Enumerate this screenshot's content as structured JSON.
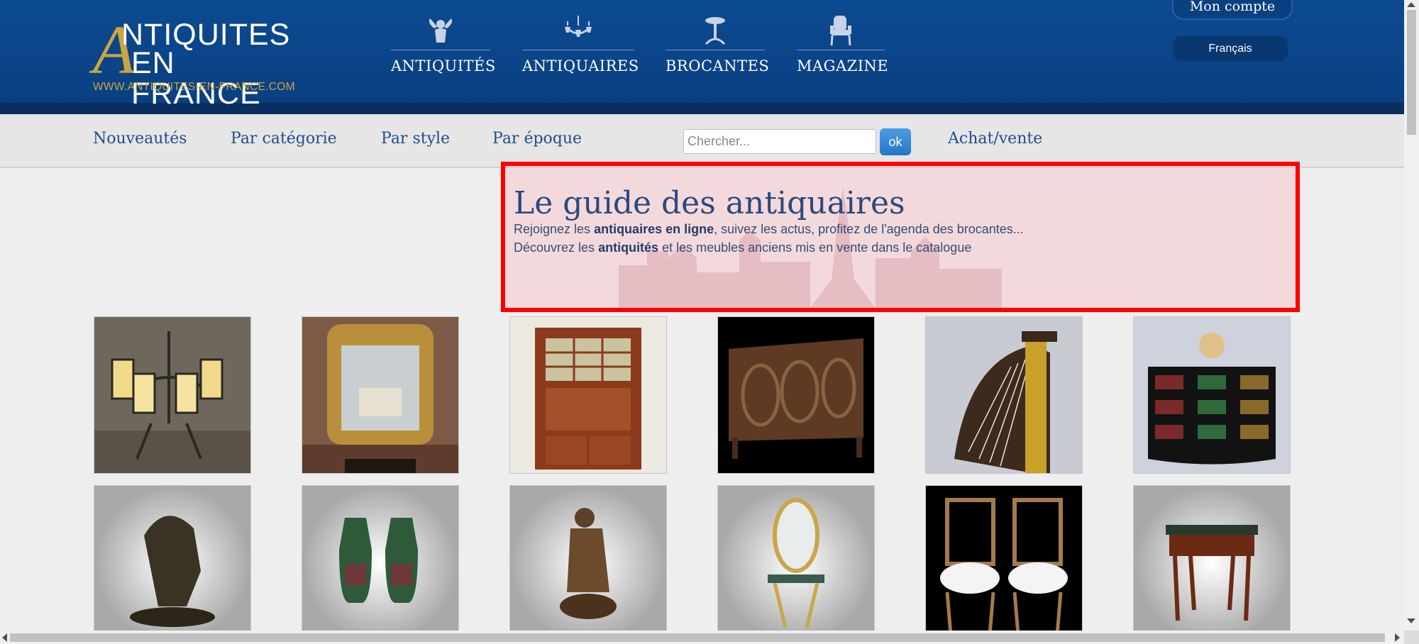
{
  "header": {
    "logo": {
      "line1": "NTIQUITES",
      "line2": "EN FRANCE",
      "big_letter": "A",
      "url": "WWW.ANTIQUITES-EN-FRANCE.COM"
    },
    "nav": [
      {
        "label": "ANTIQUITÉS",
        "icon": "cherub-icon"
      },
      {
        "label": "ANTIQUAIRES",
        "icon": "chandelier-icon"
      },
      {
        "label": "BROCANTES",
        "icon": "gueridon-table-icon"
      },
      {
        "label": "MAGAZINE",
        "icon": "armchair-icon"
      }
    ],
    "account_label": "Mon compte",
    "language": "Français"
  },
  "subnav": {
    "links": [
      "Nouveautés",
      "Par catégorie",
      "Par style",
      "Par époque"
    ],
    "search_placeholder": "Chercher...",
    "search_button": "ok",
    "buy_sell": "Achat/vente"
  },
  "hero": {
    "title": "Le guide des antiquaires",
    "line1": {
      "pre": "Rejoignez les ",
      "bold": "antiquaires en ligne",
      "post": ", suivez les actus, profitez de l'agenda des brocantes..."
    },
    "line2": {
      "pre": "Découvrez les ",
      "bold": "antiquités",
      "post": " et les meubles anciens mis en vente dans le catalogue"
    }
  },
  "products": [
    {
      "name": "lantern-chandelier-photo"
    },
    {
      "name": "gilded-mirror-photo"
    },
    {
      "name": "secretary-desk-photo"
    },
    {
      "name": "carved-sideboard-photo"
    },
    {
      "name": "golden-harp-photo"
    },
    {
      "name": "bookcase-globe-photo"
    },
    {
      "name": "bronze-horse-photo"
    },
    {
      "name": "green-vases-photo"
    },
    {
      "name": "bronze-statue-photo"
    },
    {
      "name": "gilt-console-mirror-photo"
    },
    {
      "name": "pair-of-chairs-photo"
    },
    {
      "name": "side-table-photo"
    }
  ],
  "colors": {
    "header_blue": "#0c4a91",
    "gold": "#c9a640",
    "highlight_border": "#ff0000",
    "link_blue": "#1f4e8c"
  }
}
